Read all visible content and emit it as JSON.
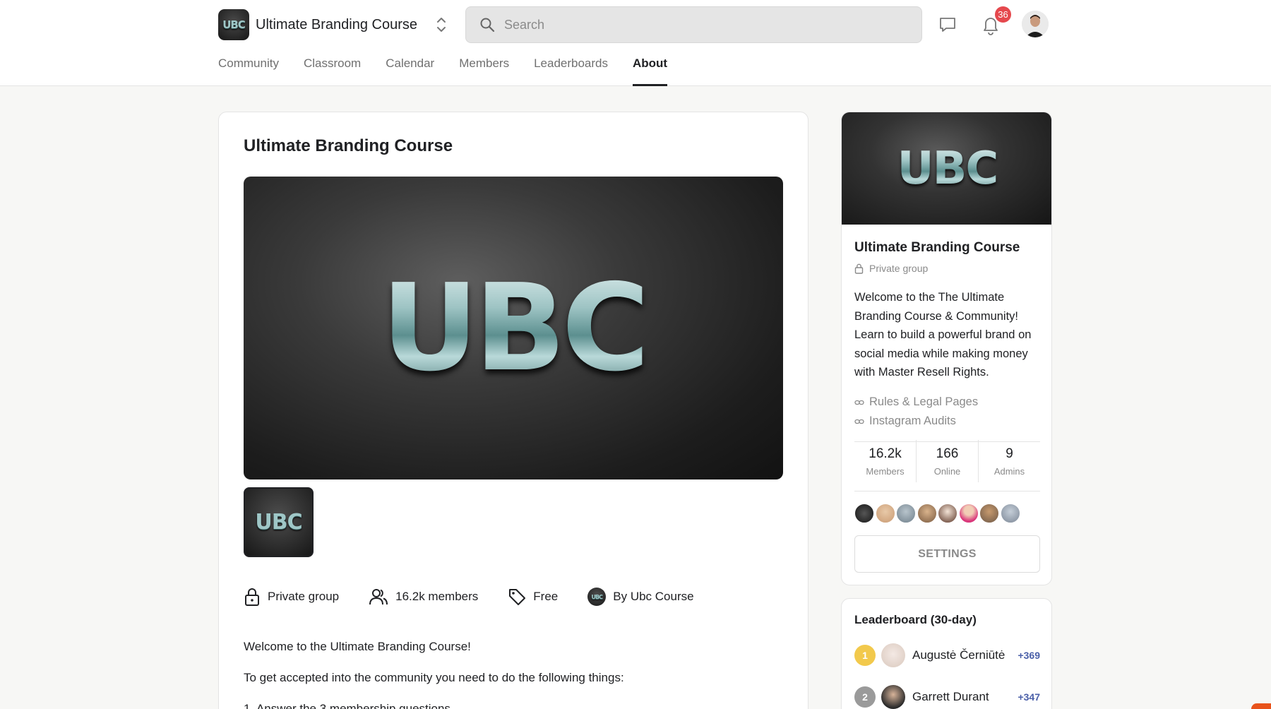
{
  "header": {
    "group_name": "Ultimate Branding Course",
    "logo_text": "UBC",
    "search_placeholder": "Search",
    "notification_count": "36"
  },
  "tabs": [
    {
      "label": "Community"
    },
    {
      "label": "Classroom"
    },
    {
      "label": "Calendar"
    },
    {
      "label": "Members"
    },
    {
      "label": "Leaderboards"
    },
    {
      "label": "About",
      "active": true
    }
  ],
  "main": {
    "title": "Ultimate Branding Course",
    "hero_text": "UBC",
    "meta": {
      "privacy": "Private group",
      "members": "16.2k members",
      "price": "Free",
      "owner": "By Ubc Course"
    },
    "description": [
      "Welcome to the Ultimate Branding Course!",
      "To get accepted into the community you need to do the following things:",
      "1. Answer the 3 membership questions"
    ]
  },
  "sidebar": {
    "title": "Ultimate Branding Course",
    "privacy": "Private group",
    "description": "Welcome to the The Ultimate Branding Course & Community! Learn to build a powerful brand on social media while making money with Master Resell Rights.",
    "links": [
      {
        "label": "Rules & Legal Pages"
      },
      {
        "label": "Instagram Audits"
      }
    ],
    "stats": [
      {
        "value": "16.2k",
        "label": "Members"
      },
      {
        "value": "166",
        "label": "Online"
      },
      {
        "value": "9",
        "label": "Admins"
      }
    ],
    "settings_label": "SETTINGS"
  },
  "leaderboard": {
    "title": "Leaderboard (30-day)",
    "rows": [
      {
        "rank": "1",
        "name": "Augustė Černiūtė",
        "points": "+369"
      },
      {
        "rank": "2",
        "name": "Garrett Durant",
        "points": "+347"
      }
    ]
  },
  "colors": {
    "accent": "#202124",
    "badge": "#e5484d",
    "points": "#4a5fa8",
    "gold": "#f2c94c",
    "silver": "#9a9a9a"
  }
}
